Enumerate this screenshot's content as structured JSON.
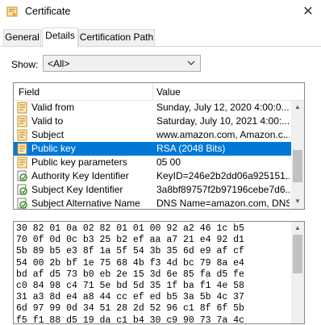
{
  "window": {
    "title": "Certificate",
    "close_glyph": "✕"
  },
  "tabs": [
    {
      "label": "General"
    },
    {
      "label": "Details"
    },
    {
      "label": "Certification Path"
    }
  ],
  "show": {
    "label": "Show:",
    "value": "<All>"
  },
  "table": {
    "columns": [
      "Field",
      "Value"
    ],
    "rows": [
      {
        "field": "Valid from",
        "value": "Sunday, July 12, 2020 4:00:0...",
        "icon": "certificate-field-icon"
      },
      {
        "field": "Valid to",
        "value": "Saturday, July 10, 2021 4:00:...",
        "icon": "certificate-field-icon"
      },
      {
        "field": "Subject",
        "value": "www.amazon.com, Amazon.c...",
        "icon": "certificate-field-icon"
      },
      {
        "field": "Public key",
        "value": "RSA (2048 Bits)",
        "icon": "certificate-field-icon",
        "selected": true
      },
      {
        "field": "Public key parameters",
        "value": "05 00",
        "icon": "certificate-field-icon"
      },
      {
        "field": "Authority Key Identifier",
        "value": "KeyID=246e2b2dd06a925151...",
        "icon": "extension-icon"
      },
      {
        "field": "Subject Key Identifier",
        "value": "3a8bf89757f2b97196cebe7d6...",
        "icon": "extension-icon"
      },
      {
        "field": "Subject Alternative Name",
        "value": "DNS Name=amazon.com, DNS...",
        "icon": "extension-icon"
      }
    ]
  },
  "hex": {
    "lines": [
      "30 82 01 0a 02 82 01 01 00 92 a2 46 1c b5",
      "70 0f 0d 0c b3 25 b2 ef aa a7 21 e4 92 d1",
      "5b 89 b5 e3 8f 1a 5f 54 3b 35 6d e9 af cf",
      "54 00 2b bf 1e 75 68 4b f3 4d bc 79 8a e4",
      "bd af d5 73 b0 eb 2e 15 3d 6e 85 fa d5 fe",
      "c0 84 98 c4 71 5e bd 5d 35 1f ba f1 4e 58",
      "31 a3 8d e4 a8 44 cc ef ed b5 3a 5b 4c 37",
      "6d 97 99 0d 34 51 28 2d 52 96 c1 8f 6f 5b",
      "f5 f1 88 d5 19 da c1 b4 30 c9 90 73 7a 4c"
    ]
  },
  "colors": {
    "selection": "#0078d7",
    "icon_gold": "#e8a33b",
    "icon_green": "#3c8d2f"
  }
}
